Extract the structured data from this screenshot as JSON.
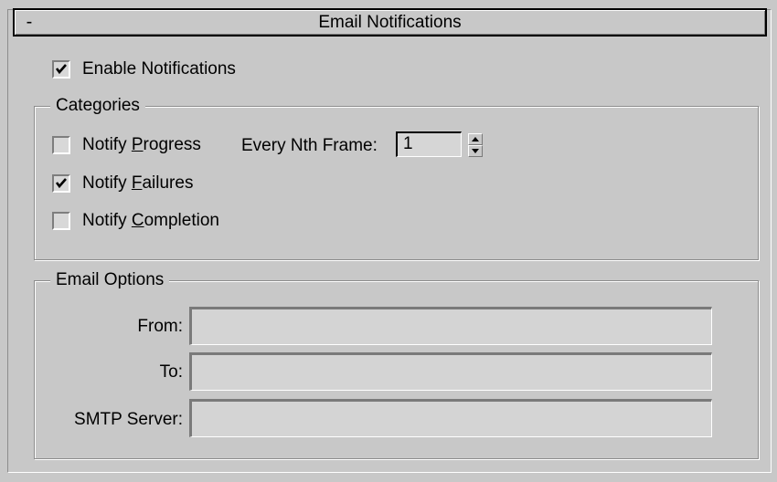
{
  "rollout": {
    "collapse_symbol": "-",
    "title": "Email Notifications"
  },
  "enable_notifications": {
    "label": "Enable Notifications",
    "checked": true
  },
  "categories": {
    "legend": "Categories",
    "notify_progress": {
      "label_pre": "Notify ",
      "label_accel": "P",
      "label_post": "rogress",
      "checked": false
    },
    "every_nth_frame": {
      "label": "Every Nth Frame:",
      "value": "1"
    },
    "notify_failures": {
      "label_pre": "Notify ",
      "label_accel": "F",
      "label_post": "ailures",
      "checked": true
    },
    "notify_completion": {
      "label_pre": "Notify ",
      "label_accel": "C",
      "label_post": "ompletion",
      "checked": false
    }
  },
  "email_options": {
    "legend": "Email Options",
    "from": {
      "label": "From:",
      "value": ""
    },
    "to": {
      "label": "To:",
      "value": ""
    },
    "smtp_server": {
      "label": "SMTP Server:",
      "value": ""
    }
  },
  "colors": {
    "panel": "#c8c8c8",
    "field": "#d4d4d4",
    "shadow": "#7a7a7a",
    "highlight": "#ffffff"
  }
}
